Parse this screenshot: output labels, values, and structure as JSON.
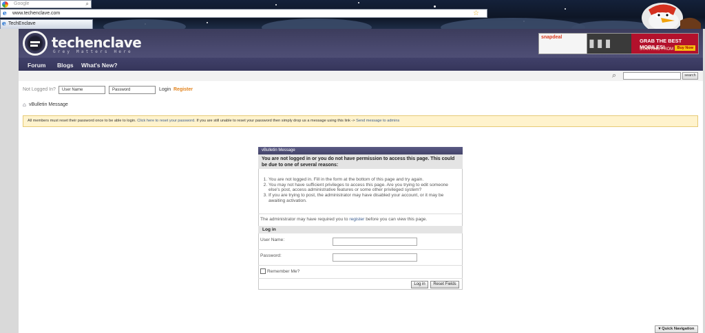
{
  "browser": {
    "search_placeholder": "Google",
    "address_url": "www.techenclave.com",
    "tab_title": "TechEnclave"
  },
  "site": {
    "logo_name": "techenclave",
    "logo_tagline": "Grey Matters Here",
    "ad": {
      "brand": "snapdeal",
      "headline": "GRAB THE BEST MOBILES!",
      "subtext": "STARTING FROM ₹899/-",
      "cta": "Buy Now"
    },
    "nav": [
      "Forum",
      "Blogs",
      "What's New?"
    ],
    "search_button": "search"
  },
  "login_row": {
    "not_logged_in": "Not Logged In?",
    "username_placeholder": "User Name",
    "password_placeholder": "Password",
    "login_label": "Login",
    "register_label": "Register"
  },
  "breadcrumb": {
    "current": "vBulletin Message"
  },
  "notice": {
    "text_start": "All members must reset their password once to be able to login.",
    "link_reset": "Click here to reset your password.",
    "text_middle": "If you are still unable to reset your password then simply drop us a message using this link ->",
    "link_admins": "Send message to admins"
  },
  "message": {
    "header": "vBulletin Message",
    "reason": "You are not logged in or you do not have permission to access this page. This could be due to one of several reasons:",
    "reasons": [
      "You are not logged in. Fill in the form at the bottom of this page and try again.",
      "You may not have sufficient privileges to access this page. Are you trying to edit someone else's post, access administrative features or some other privileged system?",
      "If you are trying to post, the administrator may have disabled your account, or it may be awaiting activation."
    ],
    "admin_text_before": "The administrator may have required you to",
    "admin_link": "register",
    "admin_text_after": "before you can view this page.",
    "login_section": "Log in",
    "username_label": "User Name:",
    "password_label": "Password:",
    "remember_label": "Remember Me?",
    "login_button": "Log in",
    "reset_button": "Reset Fields"
  },
  "footer": {
    "quick_nav": "Quick Navigation"
  }
}
